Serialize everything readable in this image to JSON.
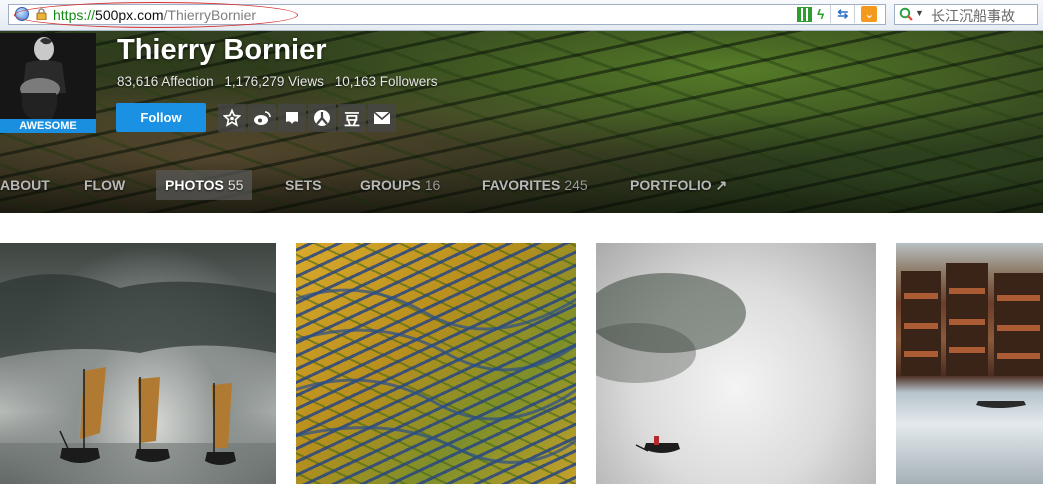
{
  "browser": {
    "url_scheme": "https://",
    "url_host": "500px.com",
    "url_path": "/ThierryBornier",
    "search_text": "长江沉船事故",
    "icons": [
      "globe-icon",
      "lock-icon",
      "qr-code-icon",
      "lightning-icon",
      "swap-arrows-icon",
      "favorite-icon",
      "search-engine-icon"
    ]
  },
  "profile": {
    "name": "Thierry Bornier",
    "badge": "AWESOME",
    "affection": "83,616 Affection",
    "views": "1,176,279 Views",
    "followers": "10,163 Followers",
    "follow_label": "Follow",
    "share_icons": [
      "star-badge-icon",
      "weibo-icon",
      "bookmark-icon",
      "renren-icon",
      "douban-icon",
      "mail-icon"
    ],
    "share_glyphs": {
      "douban": "豆"
    }
  },
  "tabs": [
    {
      "label": "ABOUT",
      "count": ""
    },
    {
      "label": "FLOW",
      "count": ""
    },
    {
      "label": "PHOTOS",
      "count": "55"
    },
    {
      "label": "SETS",
      "count": ""
    },
    {
      "label": "GROUPS",
      "count": "16"
    },
    {
      "label": "FAVORITES",
      "count": "245"
    },
    {
      "label": "PORTFOLIO ↗",
      "count": ""
    }
  ],
  "active_tab": "PHOTOS",
  "photos": [
    {
      "subject": "junk boats in misty water"
    },
    {
      "subject": "rice terraces"
    },
    {
      "subject": "boat in fog"
    },
    {
      "subject": "riverside stilt houses"
    }
  ],
  "colors": {
    "accent": "#1a91e3",
    "url_green": "#138a13",
    "annotation_red": "#d43030"
  }
}
